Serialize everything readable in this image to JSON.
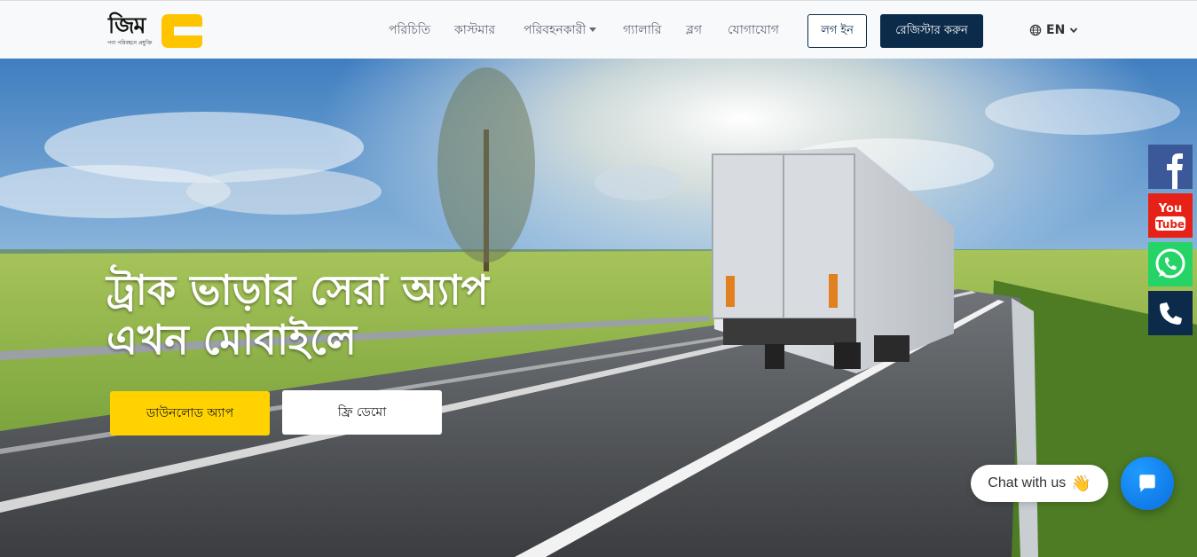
{
  "brand": {
    "name": "জিম",
    "tagline": "পণ্য পরিবহনে প্রযুক্তি",
    "accent": "#ffc400"
  },
  "nav": {
    "items": [
      {
        "label": "পরিচিতি"
      },
      {
        "label": "কাস্টমার"
      },
      {
        "label": "পরিবহনকারী",
        "dropdown": true
      },
      {
        "label": "গ্যালারি"
      },
      {
        "label": "ব্লগ"
      },
      {
        "label": "যোগাযোগ"
      }
    ],
    "login_label": "লগ ইন",
    "register_label": "রেজিস্টার করুন",
    "language": "EN",
    "language_icon": "globe-icon"
  },
  "hero": {
    "title_line1": "ট্রাক ভাড়ার সেরা অ্যাপ",
    "title_line2": "এখন মোবাইলে",
    "download_label": "ডাউনলোড অ্যাপ",
    "demo_label": "ফ্রি ডেমো"
  },
  "social": [
    {
      "name": "facebook-icon",
      "color": "#3b5998"
    },
    {
      "name": "youtube-icon",
      "color": "#e62117"
    },
    {
      "name": "whatsapp-icon",
      "color": "#25d366"
    },
    {
      "name": "phone-icon",
      "color": "#0c2b4b"
    }
  ],
  "chat": {
    "bubble_text": "Chat with us",
    "bubble_emoji": "👋",
    "button_color": "#0a84ff"
  }
}
